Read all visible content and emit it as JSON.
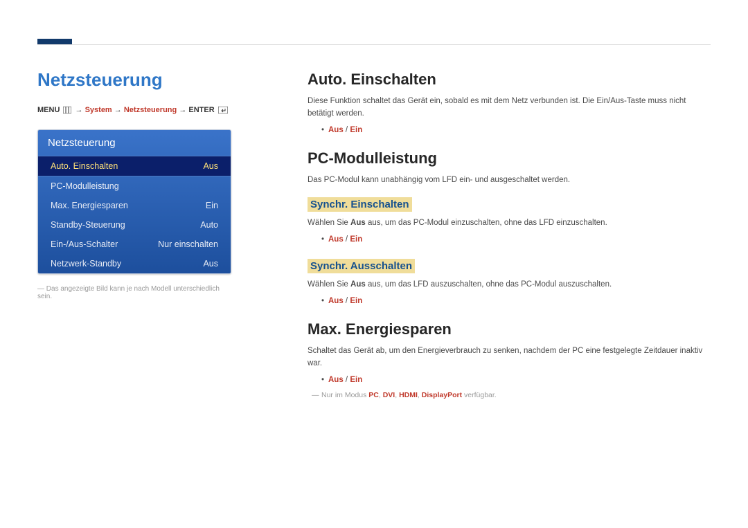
{
  "page": {
    "title": "Netzsteuerung",
    "breadcrumb": {
      "menu": "MENU",
      "arrow": "→",
      "system": "System",
      "netz": "Netzsteuerung",
      "enter": "ENTER"
    },
    "caption": "Das angezeigte Bild kann je nach Modell unterschiedlich sein."
  },
  "device_menu": {
    "title": "Netzsteuerung",
    "rows": [
      {
        "label": "Auto. Einschalten",
        "value": "Aus",
        "selected": true
      },
      {
        "label": "PC-Modulleistung",
        "value": "",
        "selected": false
      },
      {
        "label": "Max. Energiesparen",
        "value": "Ein",
        "selected": false
      },
      {
        "label": "Standby-Steuerung",
        "value": "Auto",
        "selected": false
      },
      {
        "label": "Ein-/Aus-Schalter",
        "value": "Nur einschalten",
        "selected": false
      },
      {
        "label": "Netzwerk-Standby",
        "value": "Aus",
        "selected": false
      }
    ]
  },
  "content": {
    "auto_on": {
      "heading": "Auto. Einschalten",
      "text": "Diese Funktion schaltet das Gerät ein, sobald es mit dem Netz verbunden ist. Die Ein/Aus-Taste muss nicht betätigt werden.",
      "opt_aus": "Aus",
      "opt_sep": " / ",
      "opt_ein": "Ein"
    },
    "pc_module": {
      "heading": "PC-Modulleistung",
      "text": "Das PC-Modul kann unabhängig vom LFD ein- und ausgeschaltet werden.",
      "sync_on": {
        "heading": "Synchr. Einschalten",
        "text_pre": "Wählen Sie ",
        "text_bold": "Aus",
        "text_post": " aus, um das PC-Modul einzuschalten, ohne das LFD einzuschalten.",
        "opt_aus": "Aus",
        "opt_sep": " / ",
        "opt_ein": "Ein"
      },
      "sync_off": {
        "heading": "Synchr. Ausschalten",
        "text_pre": "Wählen Sie ",
        "text_bold": "Aus",
        "text_post": " aus, um das LFD auszuschalten, ohne das PC-Modul auszuschalten.",
        "opt_aus": "Aus",
        "opt_sep": " / ",
        "opt_ein": "Ein"
      }
    },
    "max_energy": {
      "heading": "Max. Energiesparen",
      "text": "Schaltet das Gerät ab, um den Energieverbrauch zu senken, nachdem der PC eine festgelegte Zeitdauer inaktiv war.",
      "opt_aus": "Aus",
      "opt_sep": " / ",
      "opt_ein": "Ein",
      "footnote_pre": "Nur im Modus ",
      "footnote_modes_pc": "PC",
      "footnote_modes_dvi": "DVI",
      "footnote_modes_hdmi": "HDMI",
      "footnote_modes_dp": "DisplayPort",
      "footnote_comma": ", ",
      "footnote_post": " verfügbar."
    }
  }
}
